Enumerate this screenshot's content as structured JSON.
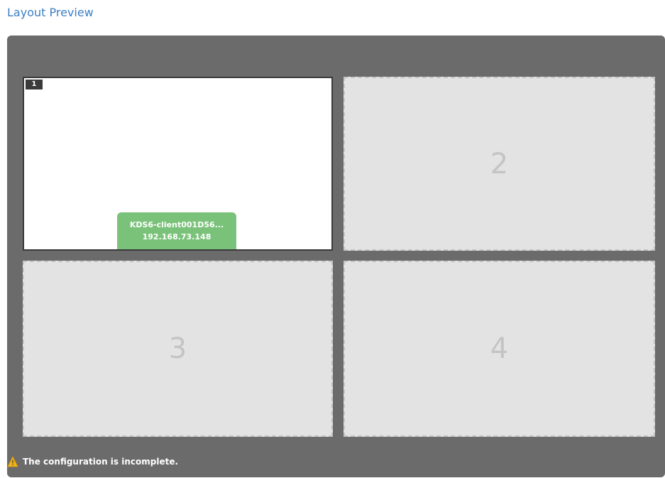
{
  "header": {
    "title": "Layout Preview"
  },
  "layout": {
    "cells": [
      {
        "number": "1",
        "state": "assigned",
        "source": {
          "name": "KDS6-client001D56...",
          "ip": "192.168.73.148"
        }
      },
      {
        "number": "2",
        "state": "empty"
      },
      {
        "number": "3",
        "state": "empty"
      },
      {
        "number": "4",
        "state": "empty"
      }
    ]
  },
  "status": {
    "icon": "warning-icon",
    "message": "The configuration is incomplete.",
    "color": "#f2b41b"
  },
  "colors": {
    "title": "#3d7fc4",
    "frame": "#6b6b6b",
    "empty_cell": "#e3e3e3",
    "assigned_cell": "#ffffff",
    "source_tag": "#7ac27a"
  }
}
